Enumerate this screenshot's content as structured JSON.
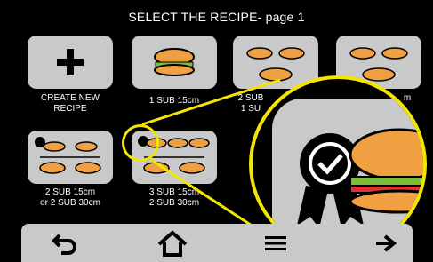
{
  "header": {
    "title": "SELECT THE RECIPE- page 1"
  },
  "recipes": [
    {
      "label": "CREATE NEW\nRECIPE",
      "icon": "plus-icon"
    },
    {
      "label": "1 SUB 15cm",
      "icon": "sandwich-icon"
    },
    {
      "label": "2 SUB 15cm\n1 SUB 30cm",
      "icon": "sandwich-icon"
    },
    {
      "label": "3 SUB 15cm",
      "icon": "sandwich-icon"
    },
    {
      "label": "2 SUB 15cm\nor 2 SUB 30cm",
      "icon": "sandwich-icon"
    },
    {
      "label": "3 SUB 15cm\n2 SUB 30cm",
      "icon": "sandwich-icon"
    }
  ],
  "visible_labels": {
    "r0a": "CREATE NEW",
    "r0b": "RECIPE",
    "r1": "1 SUB 15cm",
    "r2a": "2 SUB",
    "r2b": "1 SU",
    "r3": "m",
    "r4a": "2 SUB 15cm",
    "r4b": "or 2 SUB 30cm",
    "r5a": "3 SUB 15cm",
    "r5b": "2 SUB 30cm"
  },
  "nav": {
    "back": "back-icon",
    "home": "home-icon",
    "menu": "menu-icon",
    "next": "next-arrow-icon"
  },
  "colors": {
    "background": "#000000",
    "tile": "#c9c9c9",
    "highlight": "#f2e600",
    "icon": "#000000"
  }
}
